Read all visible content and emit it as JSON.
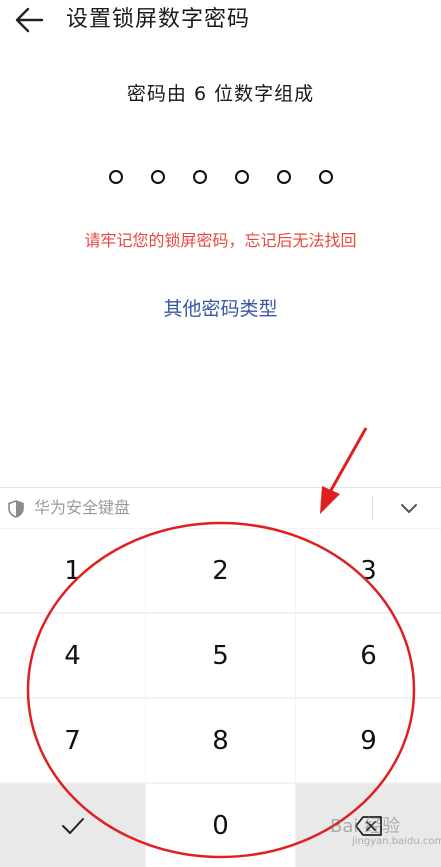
{
  "header": {
    "title": "设置锁屏数字密码",
    "back_icon": "arrow-left-icon"
  },
  "main": {
    "subtitle": "密码由 6 位数字组成",
    "pin_length": 6,
    "pin_filled": 0,
    "warning": "请牢记您的锁屏密码，忘记后无法找回",
    "other_password_link": "其他密码类型"
  },
  "keyboard": {
    "name": "华为安全键盘",
    "shield_icon": "shield-icon",
    "collapse_icon": "chevron-down-icon",
    "keys": {
      "k1": "1",
      "k2": "2",
      "k3": "3",
      "k4": "4",
      "k5": "5",
      "k6": "6",
      "k7": "7",
      "k8": "8",
      "k9": "9",
      "k0": "0"
    },
    "confirm_icon": "checkmark-icon",
    "delete_icon": "backspace-icon"
  },
  "colors": {
    "warning": "#e8473e",
    "link": "#3a57a7",
    "annotation": "#e02020"
  },
  "watermark": {
    "text": "Bai 经验",
    "sub": "jingyan.baidu.com"
  }
}
